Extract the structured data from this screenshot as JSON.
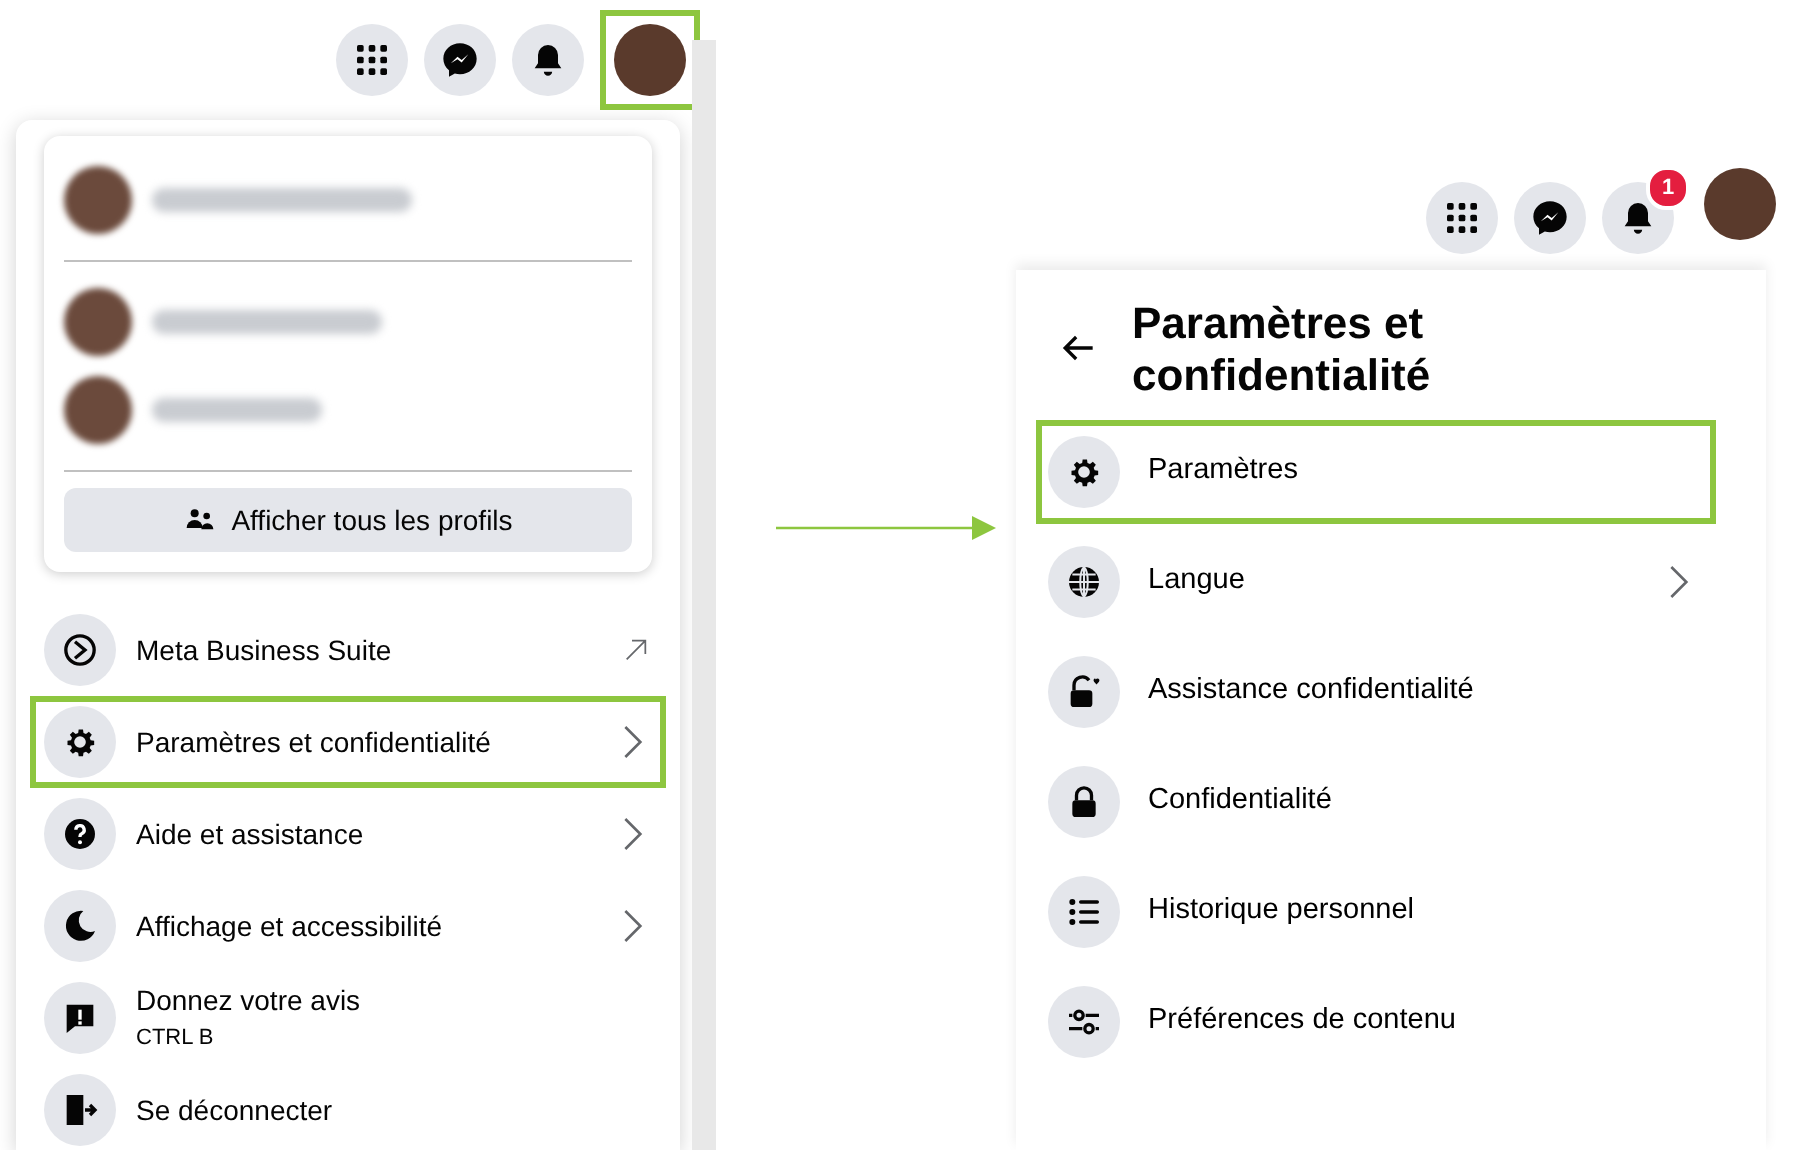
{
  "left_panel": {
    "top_icons": [
      {
        "kind": "grid",
        "highlighted": false
      },
      {
        "kind": "messenger",
        "highlighted": false
      },
      {
        "kind": "bell",
        "highlighted": false
      },
      {
        "kind": "avatar",
        "highlighted": true
      }
    ],
    "profiles_button": {
      "label": "Afficher tous les profils"
    },
    "menu": [
      {
        "kind": "business",
        "label": "Meta Business Suite",
        "external": true,
        "submenu": false,
        "highlighted": false
      },
      {
        "kind": "gear",
        "label": "Paramètres et confidentialité",
        "external": false,
        "submenu": true,
        "highlighted": true
      },
      {
        "kind": "help",
        "label": "Aide et assistance",
        "external": false,
        "submenu": true,
        "highlighted": false
      },
      {
        "kind": "moon",
        "label": "Affichage et accessibilité",
        "external": false,
        "submenu": true,
        "highlighted": false
      },
      {
        "kind": "feedback",
        "label": "Donnez votre avis",
        "sublabel": "CTRL B",
        "external": false,
        "submenu": false,
        "highlighted": false
      },
      {
        "kind": "logout",
        "label": "Se déconnecter",
        "external": false,
        "submenu": false,
        "highlighted": false
      }
    ]
  },
  "right_panel": {
    "top_icons": [
      {
        "kind": "grid",
        "highlighted": false
      },
      {
        "kind": "messenger",
        "highlighted": false
      },
      {
        "kind": "bell",
        "badge": "1",
        "highlighted": false
      },
      {
        "kind": "avatar",
        "highlighted": false
      }
    ],
    "title": "Paramètres et confidentialité",
    "menu": [
      {
        "kind": "gear",
        "label": "Paramètres",
        "submenu": false,
        "highlighted": true
      },
      {
        "kind": "globe",
        "label": "Langue",
        "submenu": true,
        "highlighted": false
      },
      {
        "kind": "privacy-check",
        "label": "Assistance confidentialité",
        "submenu": false,
        "highlighted": false
      },
      {
        "kind": "lock",
        "label": "Confidentialité",
        "submenu": false,
        "highlighted": false
      },
      {
        "kind": "list",
        "label": "Historique personnel",
        "submenu": false,
        "highlighted": false
      },
      {
        "kind": "sliders",
        "label": "Préférences de contenu",
        "submenu": false,
        "highlighted": false
      }
    ]
  }
}
